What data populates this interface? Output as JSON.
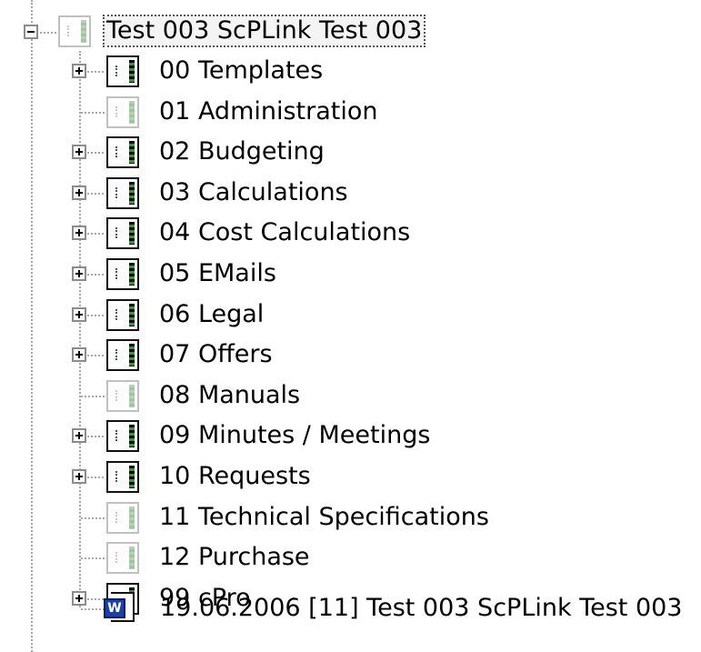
{
  "tree": {
    "root": {
      "label": "Test 003 ScPLink Test 003",
      "expanded": true,
      "selected": true
    },
    "children": [
      {
        "label": "00 Templates",
        "has_children": true
      },
      {
        "label": "01 Administration",
        "has_children": false
      },
      {
        "label": "02 Budgeting",
        "has_children": true
      },
      {
        "label": "03 Calculations",
        "has_children": true
      },
      {
        "label": "04 Cost Calculations",
        "has_children": true
      },
      {
        "label": "05 EMails",
        "has_children": true
      },
      {
        "label": "06 Legal",
        "has_children": true
      },
      {
        "label": "07 Offers",
        "has_children": true
      },
      {
        "label": "08 Manuals",
        "has_children": false
      },
      {
        "label": "09 Minutes / Meetings",
        "has_children": true
      },
      {
        "label": "10 Requests",
        "has_children": true
      },
      {
        "label": "11 Technical Specifications",
        "has_children": false
      },
      {
        "label": "12 Purchase",
        "has_children": false
      },
      {
        "label": "99 cPro",
        "has_children": true
      }
    ],
    "document": {
      "icon": "word-document-icon",
      "icon_letter": "W",
      "label": "19.06.2006  [11] Test 003 ScPLink Test 003"
    }
  },
  "colors": {
    "tree_lines": "#a8a8a8",
    "binder_border": "#111111",
    "binder_spine_green": "#2f9e2f",
    "word_icon_blue": "#1c3fa8"
  }
}
